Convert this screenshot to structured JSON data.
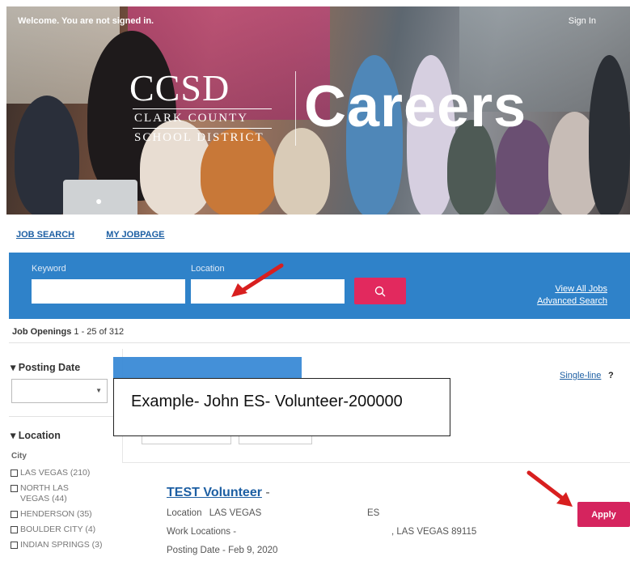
{
  "header": {
    "welcome": "Welcome. You are not signed in.",
    "sign_in": "Sign In",
    "logo_abbr": "CCSD",
    "logo_line1": "CLARK COUNTY",
    "logo_line2": "SCHOOL DISTRICT",
    "brand_title": "Careers"
  },
  "nav": {
    "job_search": "JOB SEARCH",
    "my_jobpage": "MY JOBPAGE"
  },
  "search": {
    "keyword_label": "Keyword",
    "keyword_value": "",
    "location_label": "Location",
    "location_value": "",
    "view_all": "View All Jobs",
    "advanced": "Advanced Search"
  },
  "results": {
    "openings_label": "Job Openings",
    "openings_range": "1 - 25 of 312"
  },
  "sidebar": {
    "posting_date_title": "Posting Date",
    "posting_date_value": "",
    "location_title": "Location",
    "city_label": "City",
    "cities": [
      {
        "label": "LAS VEGAS (210)"
      },
      {
        "label": "NORTH LAS VEGAS (44)"
      },
      {
        "label": "HENDERSON (35)"
      },
      {
        "label": "BOULDER CITY (4)"
      },
      {
        "label": "INDIAN SPRINGS (3)"
      }
    ]
  },
  "panel": {
    "single_line": "Single-line",
    "help": "?",
    "callout": "Example- John ES- Volunteer-200000"
  },
  "job": {
    "title": "TEST Volunteer",
    "title_suffix": "-",
    "location_label": "Location",
    "location_value": "LAS VEGAS",
    "location_extra": "ES",
    "work_locations_label": "Work Locations -",
    "work_locations_value": ", LAS VEGAS 89115",
    "posting_date": "Posting Date - Feb 9, 2020",
    "apply_label": "Apply"
  },
  "colors": {
    "search_band": "#2f82c9",
    "accent_pink": "#e2295e",
    "link_blue": "#1d5fa3",
    "arrow_red": "#d81f1f"
  }
}
